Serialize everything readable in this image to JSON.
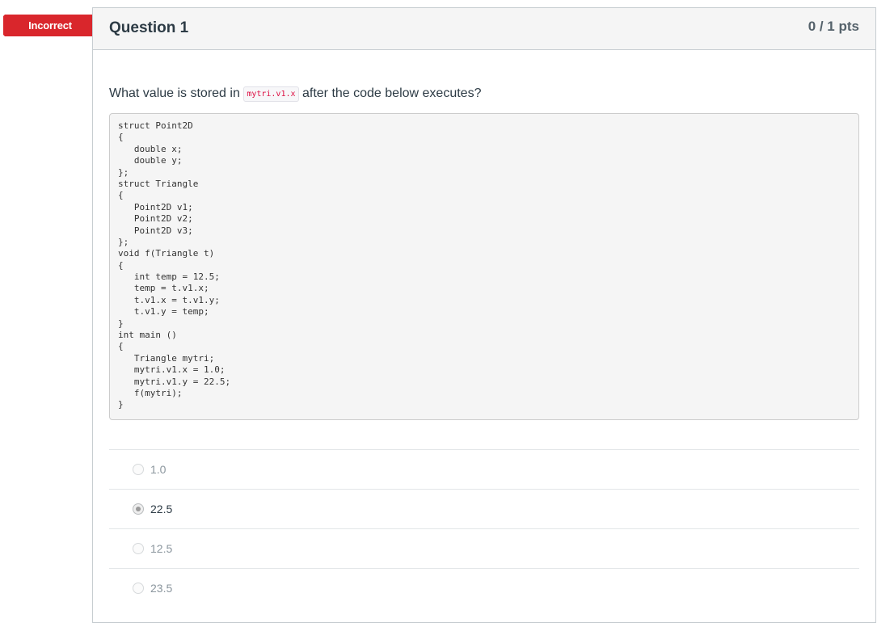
{
  "status_flag": {
    "label": "Incorrect",
    "color": "#e0292f"
  },
  "question": {
    "title": "Question 1",
    "points": "0 / 1 pts",
    "text_before": "What value is stored in",
    "inline_code": "mytri.v1.x",
    "text_after": "after the code below executes?",
    "code_lines": [
      "struct Point2D",
      "{",
      "   double x;",
      "   double y;",
      "};",
      "struct Triangle",
      "{",
      "   Point2D v1;",
      "   Point2D v2;",
      "   Point2D v3;",
      "};",
      "void f(Triangle t)",
      "{",
      "   int temp = 12.5;",
      "   temp = t.v1.x;",
      "   t.v1.x = t.v1.y;",
      "   t.v1.y = temp;",
      "}",
      "int main ()",
      "{",
      "   Triangle mytri;",
      "   mytri.v1.x = 1.0;",
      "   mytri.v1.y = 22.5;",
      "   f(mytri);",
      "}"
    ],
    "answers": [
      {
        "label": "1.0",
        "selected": false
      },
      {
        "label": "22.5",
        "selected": true
      },
      {
        "label": "12.5",
        "selected": false
      },
      {
        "label": "23.5",
        "selected": false
      }
    ]
  }
}
